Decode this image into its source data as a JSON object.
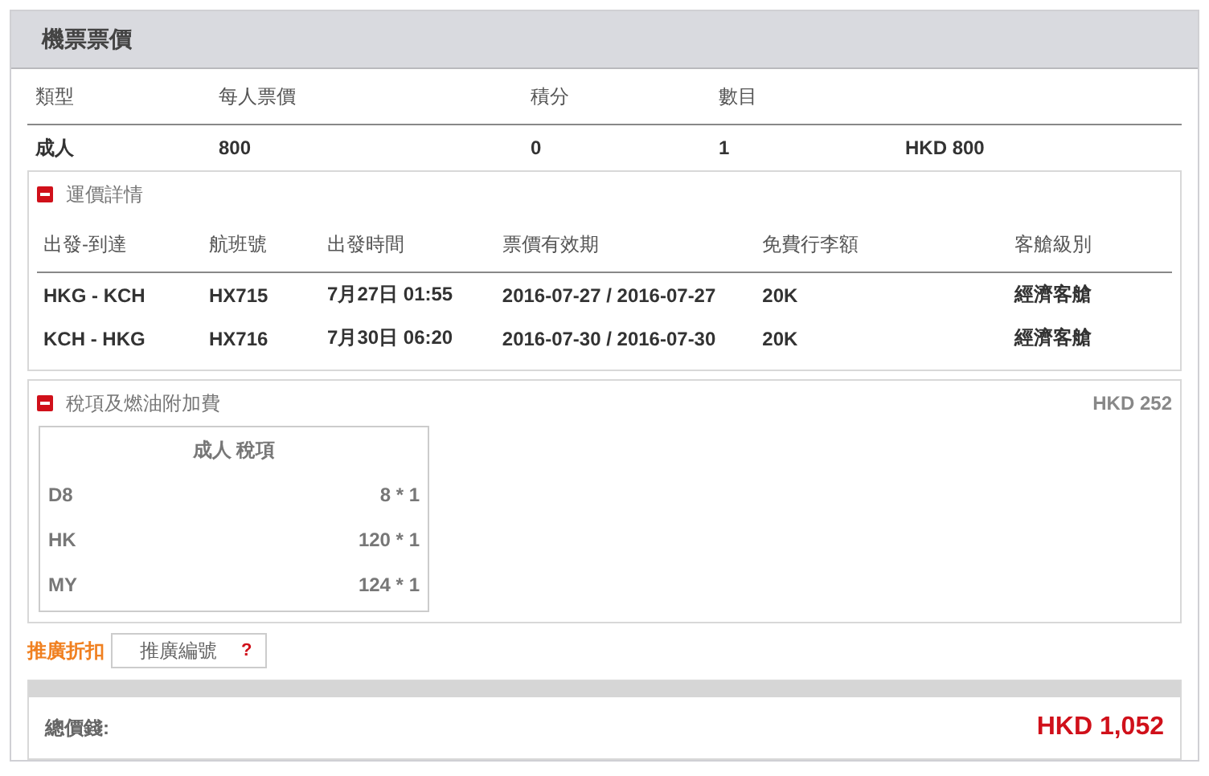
{
  "panel": {
    "title": "機票票價"
  },
  "fare_table": {
    "columns": [
      "類型",
      "每人票價",
      "積分",
      "數目"
    ],
    "rows": [
      {
        "type": "成人",
        "price": "800",
        "points": "0",
        "count": "1",
        "total": "HKD 800"
      }
    ]
  },
  "fare_details": {
    "title": "運價詳情",
    "expanded": true,
    "columns": [
      "出發-到達",
      "航班號",
      "出發時間",
      "票價有效期",
      "免費行李額",
      "客艙級別"
    ],
    "rows": [
      [
        "HKG - KCH",
        "HX715",
        "7月27日 01:55",
        "2016-07-27 / 2016-07-27",
        "20K",
        "經濟客艙"
      ],
      [
        "KCH - HKG",
        "HX716",
        "7月30日 06:20",
        "2016-07-30 / 2016-07-30",
        "20K",
        "經濟客艙"
      ]
    ]
  },
  "taxes": {
    "title": "稅項及燃油附加費",
    "amount": "HKD 252",
    "expanded": true,
    "table_title": "成人 稅項",
    "rows": [
      {
        "code": "D8",
        "value": "8 * 1"
      },
      {
        "code": "HK",
        "value": "120 * 1"
      },
      {
        "code": "MY",
        "value": "124 * 1"
      }
    ]
  },
  "promo": {
    "label": "推廣折扣",
    "placeholder": "推廣編號",
    "help": "?"
  },
  "total": {
    "label": "總價錢:",
    "amount": "HKD 1,052"
  }
}
